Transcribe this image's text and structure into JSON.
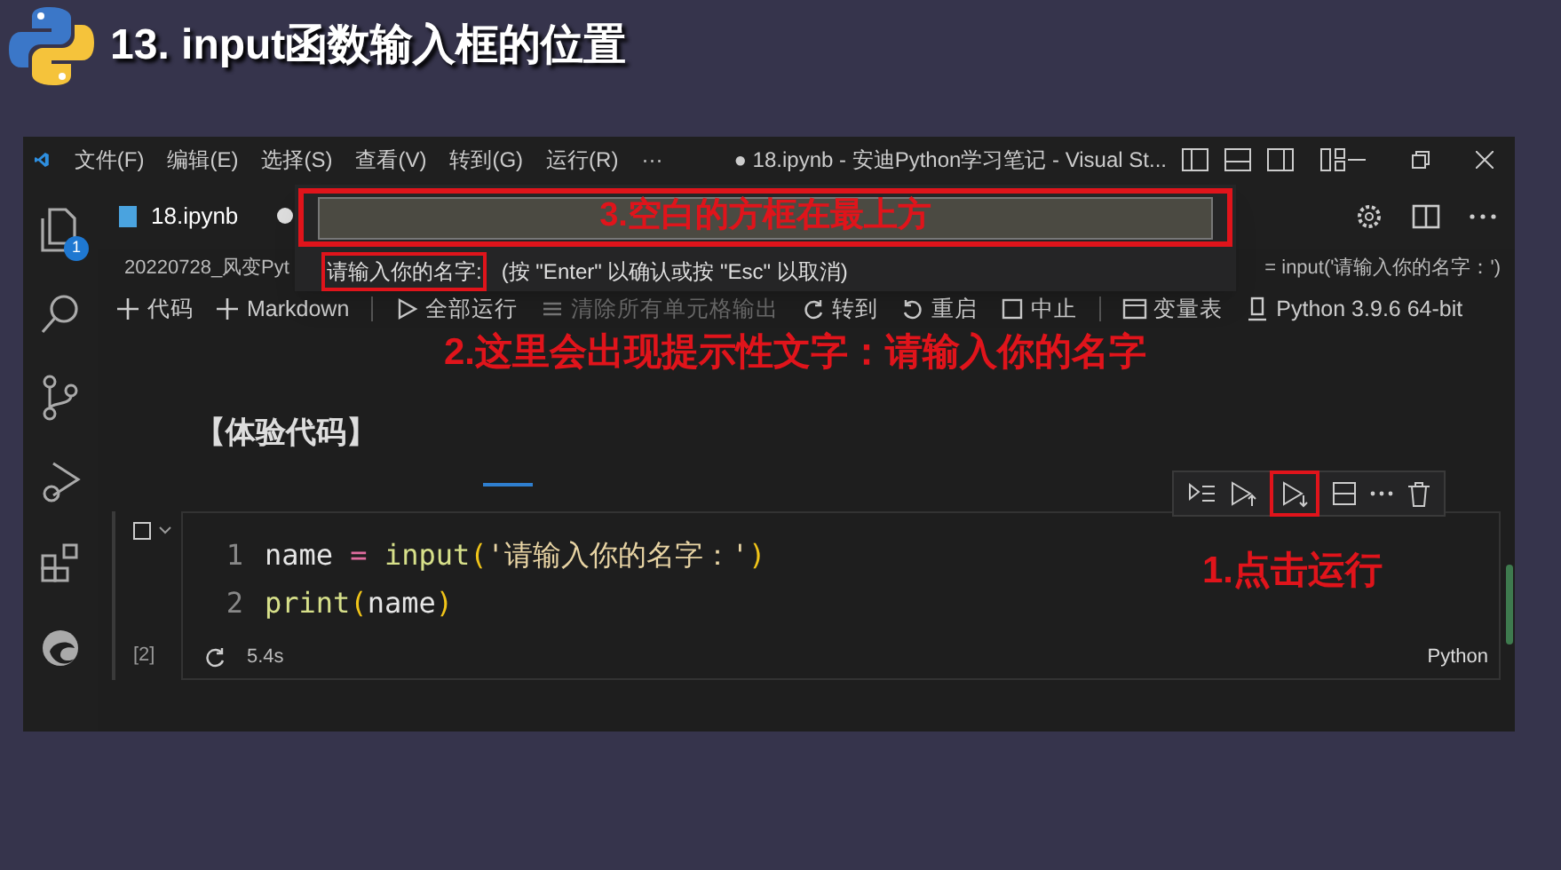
{
  "slide": {
    "title": "13. input函数输入框的位置"
  },
  "window": {
    "menu": [
      "文件(F)",
      "编辑(E)",
      "选择(S)",
      "查看(V)",
      "转到(G)",
      "运行(R)",
      "···"
    ],
    "title": "● 18.ipynb - 安迪Python学习笔记 - Visual St..."
  },
  "activity_bar": {
    "explorer_badge": "1"
  },
  "tab": {
    "label": "18.ipynb",
    "dirty": true
  },
  "breadcrumb": "20220728_风变Pyt",
  "breadcrumb_right": "= input('请输入你的名字：')",
  "quick_input": {
    "prompt": "请输入你的名字:",
    "hint": "(按 \"Enter\" 以确认或按 \"Esc\" 以取消)"
  },
  "toolbar": [
    {
      "kind": "add",
      "label": "代码",
      "disabled": false
    },
    {
      "kind": "add",
      "label": "Markdown",
      "disabled": false
    },
    {
      "kind": "run",
      "label": "全部运行",
      "disabled": false
    },
    {
      "kind": "clear",
      "label": "清除所有单元格输出",
      "disabled": true
    },
    {
      "kind": "goto",
      "label": "转到",
      "disabled": false
    },
    {
      "kind": "restart",
      "label": "重启",
      "disabled": false
    },
    {
      "kind": "stop",
      "label": "中止",
      "disabled": false
    },
    {
      "kind": "variables",
      "label": "变量表",
      "disabled": false
    },
    {
      "kind": "kernel",
      "label": "Python 3.9.6 64-bit",
      "disabled": false
    }
  ],
  "markdown_cell": {
    "text": "【体验代码】"
  },
  "code_cell": {
    "lines": [
      {
        "number": "1",
        "tokens": [
          {
            "kind": "name",
            "text": "name"
          },
          {
            "kind": "op",
            "text": " = "
          },
          {
            "kind": "func",
            "text": "input"
          },
          {
            "kind": "paren",
            "text": "("
          },
          {
            "kind": "str",
            "text": "'请输入你的名字：'"
          },
          {
            "kind": "paren",
            "text": ")"
          }
        ]
      },
      {
        "number": "2",
        "tokens": [
          {
            "kind": "func",
            "text": "print"
          },
          {
            "kind": "paren",
            "text": "("
          },
          {
            "kind": "name",
            "text": "name"
          },
          {
            "kind": "paren",
            "text": ")"
          }
        ]
      }
    ],
    "execution_count": "[2]",
    "duration": "5.4s",
    "language": "Python"
  },
  "annotations": [
    {
      "kind": "input",
      "text": "3.空白的方框在最上方"
    },
    {
      "kind": "prompt",
      "text": "2.这里会出现提示性文字：请输入你的名字"
    },
    {
      "kind": "run",
      "text": "1.点击运行"
    }
  ]
}
